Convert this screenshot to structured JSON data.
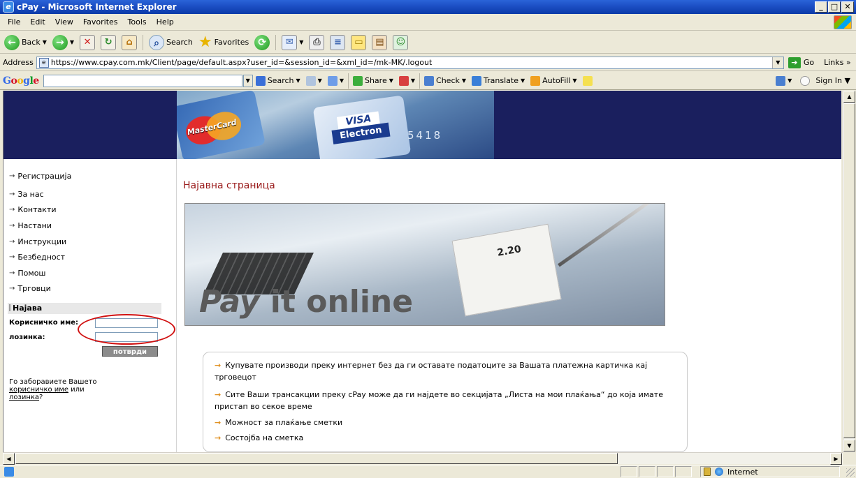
{
  "window": {
    "title": "cPay - Microsoft Internet Explorer",
    "icon": "ie-icon",
    "controls": [
      "minimize",
      "maximize",
      "close"
    ]
  },
  "menubar": {
    "items": [
      "File",
      "Edit",
      "View",
      "Favorites",
      "Tools",
      "Help"
    ]
  },
  "toolbar": {
    "back_label": "Back",
    "search_label": "Search",
    "favorites_label": "Favorites"
  },
  "address": {
    "label": "Address",
    "url": "https://www.cpay.com.mk/Client/page/default.aspx?user_id=&session_id=&xml_id=/mk-MK/.logout",
    "go_label": "Go",
    "links_label": "Links"
  },
  "google_toolbar": {
    "logo": "Google",
    "search_label": "Search",
    "share_label": "Share",
    "check_label": "Check",
    "translate_label": "Translate",
    "autofill_label": "AutoFill",
    "signin_label": "Sign In"
  },
  "banner": {
    "mastercard_text": "MasterCard",
    "visa_top": "VISA",
    "visa_bottom": "Electron",
    "card_number": "5418"
  },
  "sidebar": {
    "items": [
      "Регистрација",
      "За нас",
      "Контакти",
      "Настани",
      "Инструкции",
      "Безбедност",
      "Помош",
      "Трговци"
    ],
    "login": {
      "heading": "Најава",
      "username_label": "Корисничко име:",
      "password_label": "лозинка:",
      "submit_label": "потврди",
      "forgot_prefix": "Го заборавиете Вашето",
      "forgot_username_link": "корисничко име",
      "forgot_or": "или",
      "forgot_password_link": "лозинка",
      "forgot_suffix": "?"
    }
  },
  "main": {
    "title": "Најавна страница",
    "hero_text_1": "Pay ",
    "hero_text_2": "it online",
    "hero_receipt": "2.20",
    "info_items": [
      "Купувате производи преку интернет без да ги оставате податоците за Вашата платежна картичка кај трговецот",
      "Сите Ваши трансакции преку cPay може да ги најдете во секцијата „Листа на мои плаќања“ до која имате пристап во секое време",
      "Можност за плаќање сметки",
      "Состојба на сметка"
    ]
  },
  "statusbar": {
    "zone_label": "Internet"
  },
  "colors": {
    "banner_bg": "#1a1f5e",
    "title_red": "#9a1b1b",
    "bullet_orange": "#e09020",
    "annotation_red": "#d01010"
  }
}
